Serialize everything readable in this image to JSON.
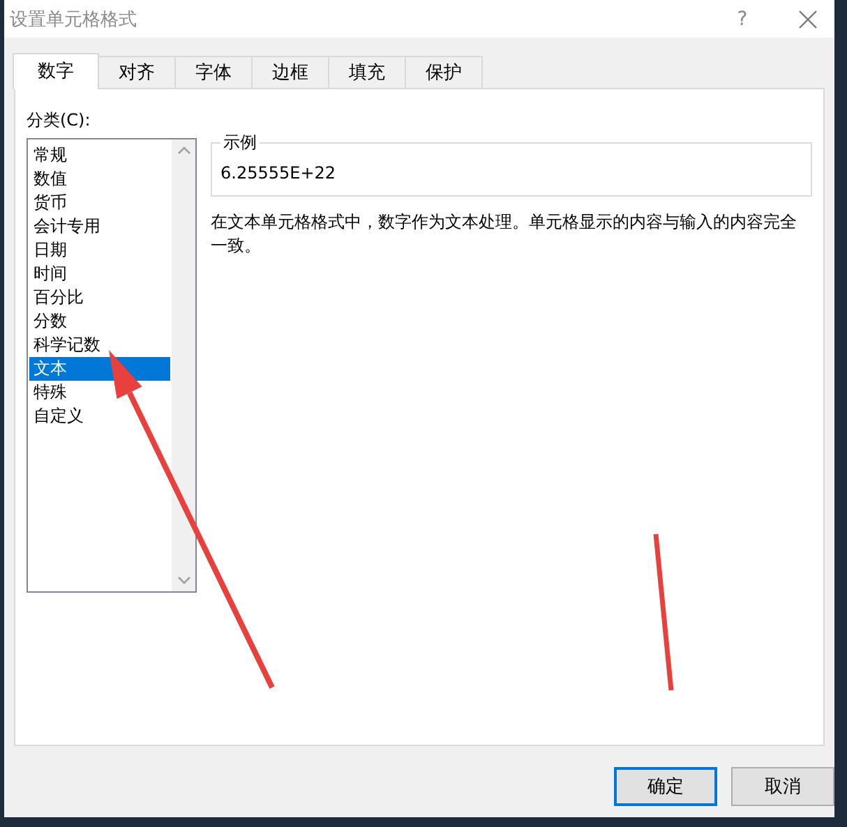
{
  "window": {
    "title": "设置单元格格式",
    "help": "?"
  },
  "tabs": [
    {
      "label": "数字",
      "selected": true
    },
    {
      "label": "对齐",
      "selected": false
    },
    {
      "label": "字体",
      "selected": false
    },
    {
      "label": "边框",
      "selected": false
    },
    {
      "label": "填充",
      "selected": false
    },
    {
      "label": "保护",
      "selected": false
    }
  ],
  "category": {
    "label": "分类(C):",
    "items": [
      {
        "label": "常规",
        "selected": false
      },
      {
        "label": "数值",
        "selected": false
      },
      {
        "label": "货币",
        "selected": false
      },
      {
        "label": "会计专用",
        "selected": false
      },
      {
        "label": "日期",
        "selected": false
      },
      {
        "label": "时间",
        "selected": false
      },
      {
        "label": "百分比",
        "selected": false
      },
      {
        "label": "分数",
        "selected": false
      },
      {
        "label": "科学记数",
        "selected": false
      },
      {
        "label": "文本",
        "selected": true
      },
      {
        "label": "特殊",
        "selected": false
      },
      {
        "label": "自定义",
        "selected": false
      }
    ]
  },
  "sample": {
    "label": "示例",
    "value": "6.25555E+22"
  },
  "description": "在文本单元格格式中，数字作为文本处理。单元格显示的内容与输入的内容完全一致。",
  "buttons": [
    {
      "label": "确定",
      "default": true
    },
    {
      "label": "取消",
      "default": false
    }
  ],
  "annotations": [
    {
      "kind": "arrow"
    },
    {
      "kind": "line"
    }
  ]
}
